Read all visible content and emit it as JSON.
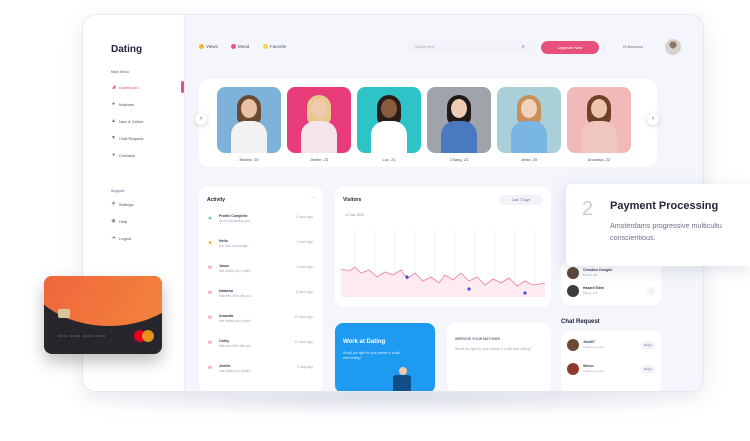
{
  "sidebar": {
    "brand": "Dating",
    "main_menu_label": "Main Menu",
    "items": [
      {
        "label": "Dashboard",
        "icon": "chart-icon"
      },
      {
        "label": "Matches",
        "icon": "people-icon"
      },
      {
        "label": "New & Online",
        "icon": "person-icon"
      },
      {
        "label": "Chat Request",
        "icon": "chat-icon"
      },
      {
        "label": "Contacts",
        "icon": "contacts-icon"
      }
    ],
    "support_label": "Support",
    "support_items": [
      {
        "label": "Settings",
        "icon": "gear-icon"
      },
      {
        "label": "Help",
        "icon": "help-icon"
      },
      {
        "label": "Logout",
        "icon": "logout-icon"
      }
    ]
  },
  "header": {
    "chips": [
      {
        "label": "Views",
        "color": "#f5b731"
      },
      {
        "label": "Mood",
        "color": "#e8517d"
      },
      {
        "label": "Favorite",
        "color": "#f7d24a"
      }
    ],
    "search_placeholder": "Search here",
    "upgrade_label": "Upgrade Now",
    "user_name": "Hi Alexandra"
  },
  "profiles": [
    {
      "name": "Beatriz, 26",
      "bg": "#7fb2d8",
      "skin": "#e9c2a6",
      "hair": "#6b4a34",
      "shirt": "#f2f2f2"
    },
    {
      "name": "Jenifer, 23",
      "bg": "#e83c7a",
      "skin": "#f1c9ae",
      "hair": "#e7c98b",
      "shirt": "#f5e4ea"
    },
    {
      "name": "Lux, 21",
      "bg": "#2ec3c6",
      "skin": "#8a5a3e",
      "hair": "#2a1d17",
      "shirt": "#ffffff"
    },
    {
      "name": "Chang, 23",
      "bg": "#a0a3aa",
      "skin": "#edccb4",
      "hair": "#1f1a17",
      "shirt": "#4a79c0"
    },
    {
      "name": "Jenia, 25",
      "bg": "#a9cfd8",
      "skin": "#f1d2bc",
      "hair": "#c89058",
      "shirt": "#79b6e4"
    },
    {
      "name": "Anushka, 22",
      "bg": "#f2b9b9",
      "skin": "#efc5ab",
      "hair": "#6e4028",
      "shirt": "#f0c7c0"
    }
  ],
  "activity": {
    "title": "Activity",
    "more": "···",
    "items": [
      {
        "name": "Profile Complete",
        "desc": "so on completing your",
        "time": "2 hours ago",
        "color": "#2dbe7f",
        "icon": "check-icon"
      },
      {
        "name": "Hello",
        "desc": "you sent a message",
        "time": "1 hours ago",
        "color": "#f5a623",
        "icon": "chat-icon"
      },
      {
        "name": "Jason",
        "desc": "has visited your profile",
        "time": "3 hours ago",
        "color": "#e8517d",
        "icon": "mail-icon"
      },
      {
        "name": "Natasha",
        "desc": "Matched 40% with you",
        "time": "8 hours ago",
        "color": "#e8517d",
        "icon": "mail-icon"
      },
      {
        "name": "Amanda",
        "desc": "has visited your profile",
        "time": "10 hours ago",
        "color": "#e8517d",
        "icon": "mail-icon"
      },
      {
        "name": "Cathy",
        "desc": "Matched 65% with you",
        "time": "12 hours ago",
        "color": "#e8517d",
        "icon": "mail-icon"
      },
      {
        "name": "Jenifer",
        "desc": "has visited your profile",
        "time": "2 days ago",
        "color": "#e8517d",
        "icon": "mail-icon"
      }
    ]
  },
  "visitors": {
    "title": "Visitors",
    "range": "Last 7 Days",
    "date": "12 Jan 2020"
  },
  "work": {
    "title": "Work at Dating",
    "desc": "Would you fight for your partner in a wild west setting?"
  },
  "improve": {
    "title": "IMPROVE YOUR MATCHES",
    "desc": "Would you fight for your partner in a wild west setting?"
  },
  "right_col": {
    "matches": [
      {
        "name": "Christine Dongler",
        "sub": "Bristol, UK",
        "color": "#5b4636"
      },
      {
        "name": "Hazard Eden",
        "sub": "Bristol, UK",
        "color": "#3d3d3d"
      }
    ],
    "chat_title": "Chat Request",
    "chats": [
      {
        "name": "Jack97",
        "sub": "Looking for you",
        "btn": "Reply",
        "color": "#6b4a34"
      },
      {
        "name": "Simon",
        "sub": "Looking for you",
        "btn": "Reply",
        "color": "#8e3a2f"
      }
    ]
  },
  "payment": {
    "number": "2",
    "title": "Payment Processing",
    "desc_line1": "Amsterdams progressive multicultu",
    "desc_line2": "conscientious."
  },
  "credit_card": {
    "number": "0000 0000 0000 0000"
  }
}
